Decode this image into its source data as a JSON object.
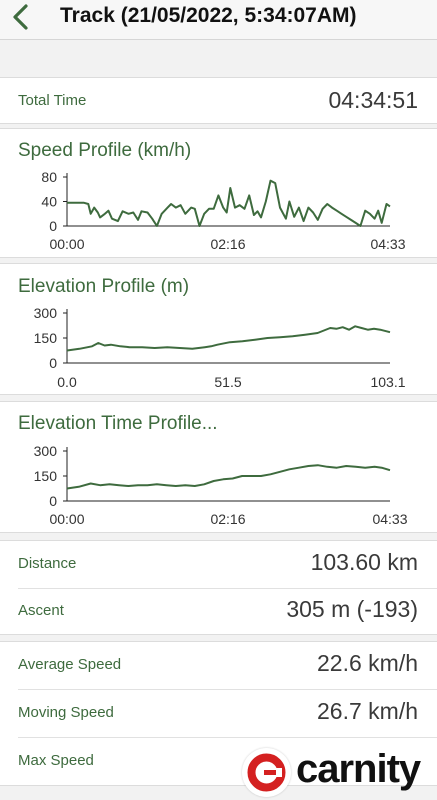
{
  "header": {
    "title": "Track (21/05/2022, 5:34:07AM)"
  },
  "total_time": {
    "label": "Total Time",
    "value": "04:34:51"
  },
  "speed_chart": {
    "title": "Speed Profile (km/h)",
    "y_ticks": [
      "80",
      "40",
      "0"
    ],
    "x_ticks": [
      "00:00",
      "02:16",
      "04:33"
    ]
  },
  "elevation_chart": {
    "title": "Elevation Profile (m)",
    "y_ticks": [
      "300",
      "150",
      "0"
    ],
    "x_ticks": [
      "0.0",
      "51.5",
      "103.1"
    ]
  },
  "elevation_time_chart": {
    "title": "Elevation Time Profile...",
    "y_ticks": [
      "300",
      "150",
      "0"
    ],
    "x_ticks": [
      "00:00",
      "02:16",
      "04:33"
    ]
  },
  "stats": {
    "distance": {
      "label": "Distance",
      "value": "103.60 km"
    },
    "ascent": {
      "label": "Ascent",
      "value": "305 m (-193)"
    },
    "average_speed": {
      "label": "Average Speed",
      "value": "22.6 km/h"
    },
    "moving_speed": {
      "label": "Moving Speed",
      "value": "26.7 km/h"
    },
    "max_speed": {
      "label": "Max Speed",
      "value": ""
    }
  },
  "logo": {
    "text": "carnity"
  },
  "chart_data": [
    {
      "type": "line",
      "ylabel": "",
      "ylim": [
        0,
        80
      ],
      "x_range": [
        "00:00",
        "04:33"
      ],
      "x_minutes": [
        0,
        8,
        14,
        18,
        20,
        23,
        26,
        28,
        32,
        35,
        38,
        43,
        47,
        52,
        56,
        60,
        63,
        68,
        72,
        76,
        80,
        85,
        88,
        92,
        96,
        100,
        105,
        108,
        112,
        116,
        120,
        124,
        128,
        132,
        135,
        138,
        142,
        146,
        150,
        154,
        158,
        161,
        164,
        168,
        172,
        176,
        180,
        185,
        188,
        192,
        196,
        200,
        204,
        208,
        212,
        216,
        220,
        224,
        228,
        232,
        236,
        240,
        244,
        248,
        252,
        256,
        260,
        263,
        266,
        270,
        273
      ],
      "values": [
        38,
        38,
        38,
        36,
        20,
        30,
        22,
        14,
        20,
        25,
        12,
        8,
        24,
        20,
        22,
        10,
        24,
        22,
        12,
        0,
        20,
        30,
        36,
        30,
        34,
        20,
        30,
        28,
        0,
        20,
        28,
        28,
        50,
        30,
        22,
        62,
        30,
        34,
        28,
        50,
        18,
        24,
        14,
        40,
        74,
        70,
        30,
        12,
        40,
        15,
        30,
        8,
        30,
        22,
        10,
        28,
        36,
        30,
        25,
        20,
        15,
        10,
        5,
        0,
        25,
        20,
        12,
        25,
        5,
        36,
        32
      ]
    },
    {
      "type": "line",
      "ylabel": "",
      "ylim": [
        0,
        300
      ],
      "x_range": [
        0.0,
        103.1
      ],
      "x_km": [
        0,
        4,
        8,
        10,
        12,
        14,
        17,
        20,
        24,
        28,
        32,
        36,
        40,
        44,
        46,
        48,
        52,
        56,
        60,
        64,
        68,
        72,
        76,
        80,
        84,
        86,
        88,
        90,
        92,
        94,
        96,
        98,
        100,
        103.1
      ],
      "values": [
        75,
        85,
        100,
        120,
        105,
        110,
        100,
        95,
        95,
        90,
        95,
        90,
        85,
        95,
        100,
        110,
        125,
        130,
        140,
        150,
        155,
        160,
        170,
        180,
        210,
        205,
        215,
        200,
        220,
        210,
        200,
        205,
        200,
        185
      ]
    },
    {
      "type": "line",
      "ylabel": "",
      "ylim": [
        0,
        300
      ],
      "x_range": [
        "00:00",
        "04:33"
      ],
      "x_minutes": [
        0,
        10,
        20,
        28,
        36,
        44,
        52,
        60,
        68,
        76,
        84,
        92,
        100,
        108,
        116,
        124,
        132,
        140,
        148,
        156,
        164,
        172,
        180,
        188,
        196,
        204,
        212,
        220,
        228,
        236,
        244,
        252,
        260,
        266,
        273
      ],
      "values": [
        75,
        85,
        105,
        95,
        100,
        95,
        90,
        95,
        95,
        100,
        95,
        90,
        95,
        90,
        100,
        120,
        130,
        135,
        150,
        150,
        150,
        160,
        175,
        190,
        200,
        210,
        215,
        205,
        200,
        210,
        205,
        200,
        205,
        200,
        185
      ]
    }
  ]
}
